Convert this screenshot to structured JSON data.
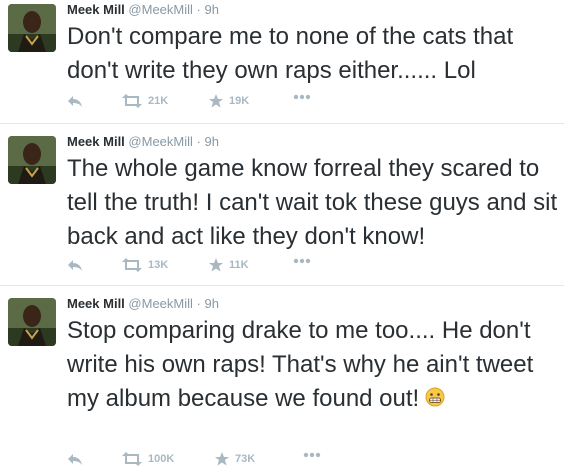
{
  "tweets": [
    {
      "name": "Meek Mill",
      "handle": "@MeekMill",
      "separator": "·",
      "time": "9h",
      "text": "Don't compare me to none of the cats that don't write they own raps either...... Lol",
      "emoji": "",
      "retweets": "21K",
      "favorites": "19K"
    },
    {
      "name": "Meek Mill",
      "handle": "@MeekMill",
      "separator": "·",
      "time": "9h",
      "text": "The whole game know forreal they scared to tell the truth!  I can't wait tok these guys and sit back and act like they don't know!",
      "emoji": "",
      "retweets": "13K",
      "favorites": "11K"
    },
    {
      "name": "Meek Mill",
      "handle": "@MeekMill",
      "separator": "·",
      "time": "9h",
      "text": "Stop comparing drake to me too.... He don't write his own raps!  That's why he ain't tweet my album because we found out!",
      "emoji": "grinning-face-emoji",
      "retweets": "100K",
      "favorites": "73K"
    }
  ],
  "icons": {
    "reply": "reply-icon",
    "retweet": "retweet-icon",
    "favorite": "star-icon",
    "more": "more-icon"
  },
  "colors": {
    "text": "#292f33",
    "muted": "#8899a6",
    "action": "#aab8c2",
    "divider": "#e1e8ed"
  }
}
